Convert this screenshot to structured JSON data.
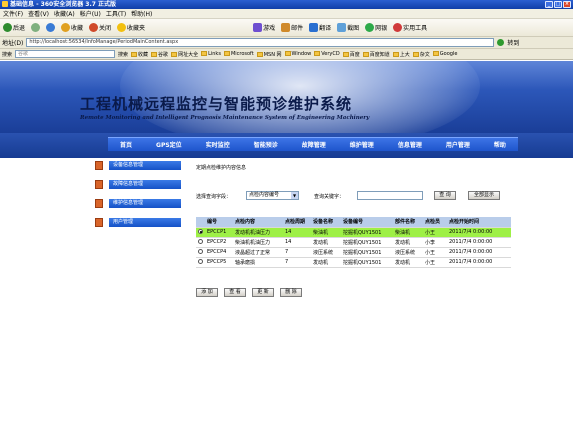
{
  "window": {
    "title": "基础信息 - 360安全浏览器 3.7 正式版"
  },
  "menu": [
    "文件(F)",
    "查看(V)",
    "收藏(A)",
    "帐户(U)",
    "工具(T)",
    "帮助(H)"
  ],
  "toolbar": [
    "后退",
    "收藏",
    "关闭",
    "收藏夹",
    "游戏",
    "邮件",
    "翻译",
    "截图",
    "网银",
    "实用工具"
  ],
  "address": {
    "label": "地址(D)",
    "url": "http://localhost:56534/InfoManage/PeriodMainContent.aspx",
    "go": "转到"
  },
  "searchbar": {
    "label": "搜索",
    "placeholder": "谷歌",
    "search_btn": "搜索",
    "links": [
      "收藏",
      "谷歌",
      "网址大全",
      "Links",
      "Microsoft",
      "MSN 网",
      "Window",
      "VeryCD",
      "百度",
      "百度知道",
      "上大",
      "杂文",
      "Google"
    ]
  },
  "banner": {
    "title": "工程机械远程监控与智能预诊维护系统",
    "subtitle": "Remote Monitoring and Intelligent Prognosis Maintenance System of Engineering Machinery"
  },
  "nav": [
    "首页",
    "GPS定位",
    "实时监控",
    "智能预诊",
    "故障管理",
    "维护管理",
    "信息管理",
    "用户管理",
    "帮助"
  ],
  "sidebar": [
    "设备信息管理",
    "故障信息管理",
    "维护信息管理",
    "用户管理"
  ],
  "breadcrumb": "定期点检维护内容信息",
  "query": {
    "field_label": "选择查询字段：",
    "field_value": "点检内容编号",
    "keyword_label": "查询关键字：",
    "keyword_value": "",
    "search_btn": "查 询",
    "show_all_btn": "全部显示"
  },
  "table": {
    "headers": [
      "",
      "编号",
      "点检内容",
      "点检周期",
      "设备名称",
      "设备编号",
      "部件名称",
      "点检员",
      "点检开始时间"
    ],
    "rows": [
      {
        "selected": true,
        "cells": [
          "EPCCP1",
          "发动机机油压力",
          "14",
          "柴油机",
          "挖掘机QUY1501",
          "柴油机",
          "小王",
          "2011/7/4 0:00:00"
        ]
      },
      {
        "selected": false,
        "cells": [
          "EPCCP2",
          "柴油机机油压力",
          "14",
          "发动机",
          "挖掘机QUY1501",
          "发动机",
          "小李",
          "2011/7/4 0:00:00"
        ]
      },
      {
        "selected": false,
        "cells": [
          "EPCCP4",
          "液晶超过了正常",
          "7",
          "液压系统",
          "挖掘机QUY1501",
          "液压系统",
          "小王",
          "2011/7/4 0:00:00"
        ]
      },
      {
        "selected": false,
        "cells": [
          "EPCCP5",
          "轴承磨损",
          "7",
          "发动机",
          "挖掘机QUY1501",
          "发动机",
          "小王",
          "2011/7/4 0:00:00"
        ]
      }
    ]
  },
  "actions": [
    "添 加",
    "查 看",
    "更 新",
    "删 除"
  ]
}
